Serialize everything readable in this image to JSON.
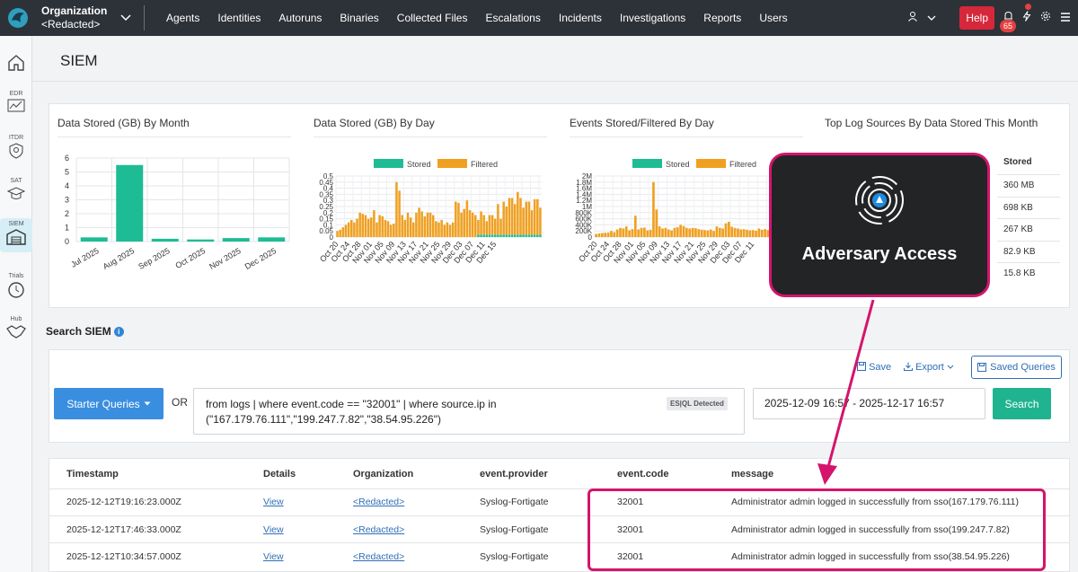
{
  "topbar": {
    "org_title": "Organization",
    "org_name": "<Redacted>",
    "nav": [
      "Agents",
      "Identities",
      "Autoruns",
      "Binaries",
      "Collected Files",
      "Escalations",
      "Incidents",
      "Investigations",
      "Reports",
      "Users"
    ],
    "help_label": "Help",
    "notification_count": "65",
    "accent_color": "#2d3138"
  },
  "sidebar": {
    "items": [
      {
        "label": "",
        "icon": "home-icon"
      },
      {
        "label": "EDR",
        "icon": "chart-line-icon"
      },
      {
        "label": "ITDR",
        "icon": "shield-icon"
      },
      {
        "label": "SAT",
        "icon": "graduation-cap-icon"
      },
      {
        "label": "SIEM",
        "icon": "warehouse-icon"
      },
      {
        "label": "Trials",
        "icon": "clock-icon"
      },
      {
        "label": "Hub",
        "icon": "handshake-icon"
      }
    ]
  },
  "page": {
    "title": "SIEM"
  },
  "charts": {
    "month_title": "Data Stored (GB) By Month",
    "day_title": "Data Stored (GB) By Day",
    "events_title": "Events Stored/Filtered By Day",
    "sources_title": "Top Log Sources By Data Stored This Month",
    "legend_stored": "Stored",
    "legend_filtered": "Filtered"
  },
  "chart_data": [
    {
      "type": "bar",
      "title": "Data Stored (GB) By Month",
      "categories": [
        "Jul 2025",
        "Aug 2025",
        "Sep 2025",
        "Oct 2025",
        "Nov 2025",
        "Dec 2025"
      ],
      "values": [
        0.3,
        5.5,
        0.2,
        0.15,
        0.25,
        0.3
      ],
      "ylim": [
        0,
        6
      ],
      "yticks": [
        "0",
        "1",
        "2",
        "3",
        "4",
        "5",
        "6"
      ],
      "color": "#1ebc94"
    },
    {
      "type": "bar",
      "title": "Data Stored (GB) By Day",
      "series": [
        {
          "name": "Stored"
        },
        {
          "name": "Filtered"
        }
      ],
      "ylim": [
        0,
        0.5
      ],
      "yticks": [
        "0",
        "0.05",
        "0.1",
        "0.15",
        "0.2",
        "0.25",
        "0.3",
        "0.35",
        "0.4",
        "0.45",
        "0.5"
      ],
      "xticks": [
        "Oct 20",
        "Oct 24",
        "Oct 28",
        "Nov 01",
        "Nov 05",
        "Nov 09",
        "Nov 13",
        "Nov 17",
        "Nov 21",
        "Nov 25",
        "Nov 29",
        "Dec 03",
        "Dec 07",
        "Dec 11",
        "Dec 15"
      ],
      "filtered": [
        0.05,
        0.06,
        0.08,
        0.1,
        0.12,
        0.14,
        0.12,
        0.15,
        0.2,
        0.19,
        0.18,
        0.15,
        0.16,
        0.22,
        0.12,
        0.18,
        0.17,
        0.14,
        0.13,
        0.1,
        0.11,
        0.45,
        0.38,
        0.18,
        0.14,
        0.2,
        0.16,
        0.12,
        0.2,
        0.24,
        0.21,
        0.17,
        0.2,
        0.2,
        0.18,
        0.13,
        0.12,
        0.14,
        0.1,
        0.12,
        0.1,
        0.12,
        0.29,
        0.28,
        0.2,
        0.23,
        0.3,
        0.22,
        0.2,
        0.18,
        0.12,
        0.19,
        0.16,
        0.11,
        0.16,
        0.16,
        0.13,
        0.25,
        0.13,
        0.27,
        0.23,
        0.3,
        0.3,
        0.25,
        0.35,
        0.3,
        0.22,
        0.27,
        0.27,
        0.2,
        0.29,
        0.29,
        0.22
      ],
      "stored": [
        0,
        0,
        0,
        0,
        0,
        0,
        0,
        0,
        0,
        0,
        0,
        0,
        0,
        0,
        0,
        0,
        0,
        0,
        0,
        0,
        0,
        0,
        0,
        0,
        0,
        0,
        0,
        0,
        0,
        0,
        0,
        0,
        0,
        0,
        0,
        0,
        0,
        0,
        0,
        0,
        0,
        0,
        0,
        0,
        0,
        0,
        0,
        0,
        0,
        0,
        0.02,
        0.02,
        0.02,
        0.02,
        0.02,
        0.02,
        0.02,
        0.02,
        0.02,
        0.02,
        0.02,
        0.02,
        0.02,
        0.02,
        0.02,
        0.02,
        0.02,
        0.02,
        0.02,
        0.02,
        0.02,
        0.02,
        0.02
      ]
    },
    {
      "type": "bar",
      "title": "Events Stored/Filtered By Day",
      "series": [
        {
          "name": "Stored"
        },
        {
          "name": "Filtered"
        }
      ],
      "ylim": [
        0,
        2000000
      ],
      "yticks": [
        "0",
        "200K",
        "400K",
        "600K",
        "800K",
        "1M",
        "1.2M",
        "1.4M",
        "1.6M",
        "1.8M",
        "2M"
      ],
      "xticks": [
        "Oct 20",
        "Oct 24",
        "Oct 28",
        "Nov 01",
        "Nov 05",
        "Nov 09",
        "Nov 13",
        "Nov 17",
        "Nov 21",
        "Nov 25",
        "Nov 29",
        "Dec 03",
        "Dec 07",
        "Dec 11"
      ],
      "filtered": [
        100000,
        120000,
        130000,
        140000,
        150000,
        200000,
        160000,
        250000,
        300000,
        280000,
        350000,
        220000,
        260000,
        700000,
        250000,
        300000,
        310000,
        220000,
        240000,
        1800000,
        900000,
        350000,
        280000,
        300000,
        250000,
        220000,
        300000,
        320000,
        400000,
        360000,
        300000,
        280000,
        300000,
        290000,
        260000,
        240000,
        230000,
        220000,
        250000,
        200000,
        350000,
        300000,
        280000,
        450000,
        500000,
        340000,
        300000,
        280000,
        250000,
        260000,
        240000,
        220000,
        230000,
        210000,
        280000,
        240000,
        260000,
        230000,
        250000
      ]
    }
  ],
  "top_sources": {
    "header": "Stored",
    "values": [
      "360 MB",
      "698 KB",
      "267 KB",
      "82.9 KB",
      "15.8 KB"
    ]
  },
  "search": {
    "label": "Search SIEM",
    "save_label": "Save",
    "export_label": "Export",
    "saved_queries_label": "Saved Queries",
    "starter_label": "Starter Queries",
    "or_label": "OR",
    "query_line1": "from logs | where event.code == \"32001\" | where source.ip in",
    "query_line2": "(\"167.179.76.111\",\"199.247.7.82\",\"38.54.95.226\")",
    "esql_badge": "ES|QL Detected",
    "date_range": "2025-12-09 16:57 - 2025-12-17 16:57",
    "search_button": "Search"
  },
  "table": {
    "columns": [
      "Timestamp",
      "Details",
      "Organization",
      "event.provider",
      "event.code",
      "message"
    ],
    "rows": [
      {
        "timestamp": "2025-12-12T19:16:23.000Z",
        "details": "View",
        "org": "<Redacted>",
        "provider": "Syslog-Fortigate",
        "code": "32001",
        "message": "Administrator admin logged in successfully from sso(167.179.76.111)"
      },
      {
        "timestamp": "2025-12-12T17:46:33.000Z",
        "details": "View",
        "org": "<Redacted>",
        "provider": "Syslog-Fortigate",
        "code": "32001",
        "message": "Administrator admin logged in successfully from sso(199.247.7.82)"
      },
      {
        "timestamp": "2025-12-12T10:34:57.000Z",
        "details": "View",
        "org": "<Redacted>",
        "provider": "Syslog-Fortigate",
        "code": "32001",
        "message": "Administrator admin logged in successfully from sso(38.54.95.226)"
      }
    ]
  },
  "callout": {
    "text": "Adversary Access",
    "border_color": "#d4146c"
  }
}
